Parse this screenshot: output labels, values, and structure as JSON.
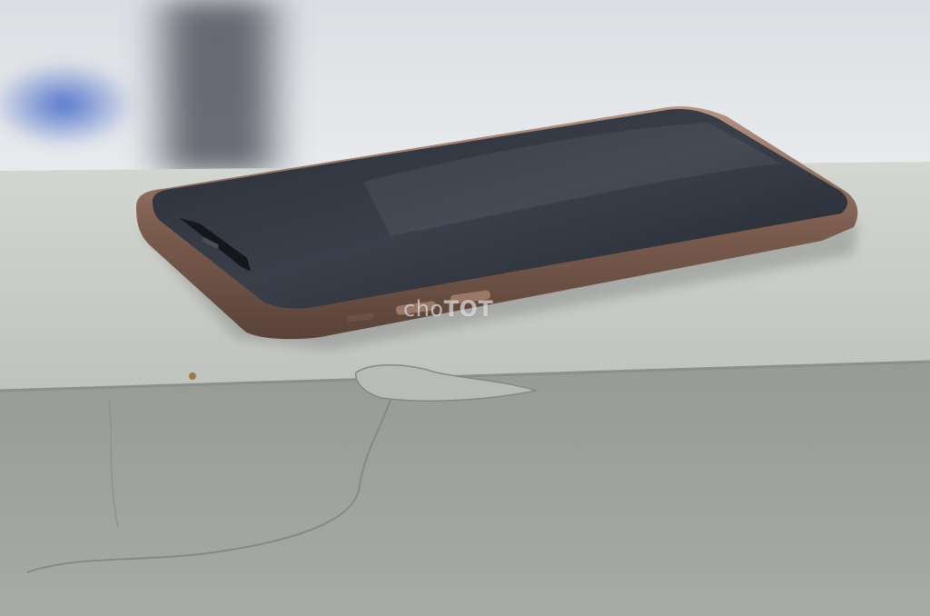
{
  "image": {
    "description_colors": {
      "background_top": "#e4e6ea",
      "background_blue_blob": "#3c64c8",
      "concrete_top": "#c9cbc6",
      "concrete_front": "#9ea29d",
      "phone_frame": "#8a6a5a",
      "phone_screen": "#23262e"
    }
  },
  "watermark": {
    "part_a": "cho",
    "part_b": "TOT"
  }
}
